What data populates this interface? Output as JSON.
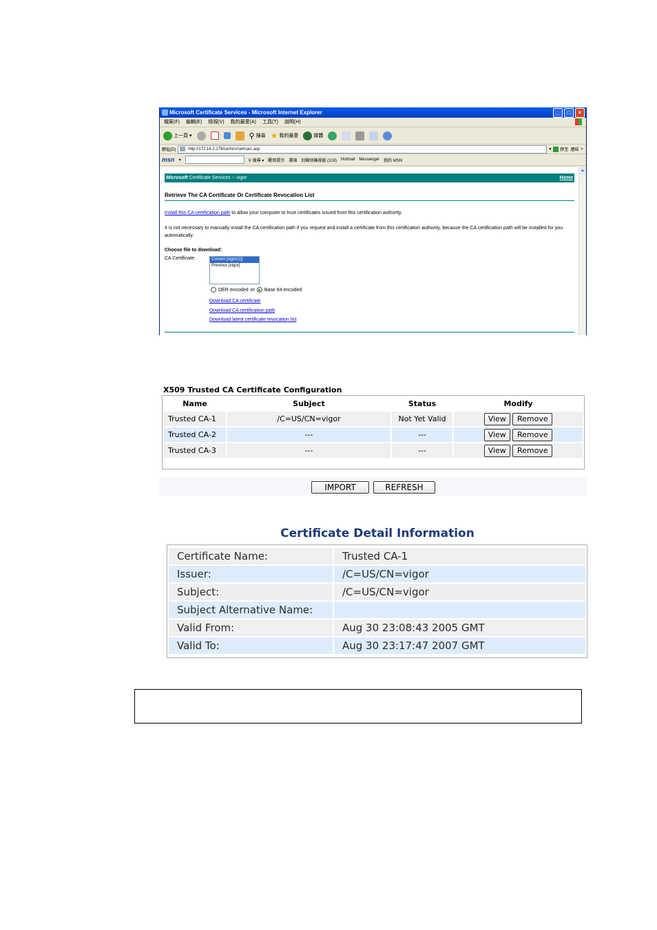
{
  "ie": {
    "title": "Microsoft Certificate Services - Microsoft Internet Explorer",
    "menu": [
      "檔案(F)",
      "編輯(E)",
      "檢視(V)",
      "我的最愛(A)",
      "工具(T)",
      "說明(H)"
    ],
    "toolbar": {
      "back": "上一頁",
      "search": "搜尋",
      "favorites": "我的最愛",
      "media": "媒體"
    },
    "address_label": "網址(D)",
    "address_value": "http://172.16.2.179/certsrv/certcarc.asp",
    "go_label": "移至",
    "links_label": "連結",
    "msn": {
      "logo": "msn",
      "search": "搜尋",
      "highlight": "醒目提示",
      "options": "選項",
      "blocked": "封鎖快顯視窗 (319)",
      "hotmail": "Hotmail",
      "messenger": "Messenger",
      "mymsn": "我的 MSN"
    },
    "page": {
      "brand": "Microsoft",
      "header_text": "Certificate Services -- vigor",
      "home": "Home",
      "title": "Retrieve The CA Certificate Or Certificate Revocation List",
      "install_link": "Install this CA certification path",
      "install_text": " to allow your computer to trust certificates issued from this certification authority.",
      "note": "It is not necessary to manually install the CA certification path if you request and install a certificate from this certification authority, because the CA certification path will be installed for you automatically.",
      "choose": "Choose file to download:",
      "ca_label": "CA Certificate:",
      "ca_options": [
        "Current [vigor(1)]",
        "Previous [vigor]"
      ],
      "der": "DER encoded",
      "or": "or",
      "base64": "Base 64 encoded",
      "links": [
        "Download CA certificate",
        "Download CA certification path",
        "Download latest certificate revocation list"
      ]
    }
  },
  "x509": {
    "title": "X509 Trusted CA Certificate Configuration",
    "headers": [
      "Name",
      "Subject",
      "Status",
      "Modify"
    ],
    "rows": [
      {
        "name": "Trusted CA-1",
        "subject": "/C=US/CN=vigor",
        "status": "Not Yet Valid"
      },
      {
        "name": "Trusted CA-2",
        "subject": "---",
        "status": "---"
      },
      {
        "name": "Trusted CA-3",
        "subject": "---",
        "status": "---"
      }
    ],
    "view_label": "View",
    "remove_label": "Remove",
    "import_label": "IMPORT",
    "refresh_label": "REFRESH"
  },
  "detail": {
    "title": "Certificate Detail Information",
    "rows": [
      {
        "key": "Certificate Name:",
        "value": "Trusted CA-1"
      },
      {
        "key": "Issuer:",
        "value": "/C=US/CN=vigor"
      },
      {
        "key": "Subject:",
        "value": "/C=US/CN=vigor"
      },
      {
        "key": "Subject Alternative Name:",
        "value": ""
      },
      {
        "key": "Valid From:",
        "value": "Aug 30 23:08:43 2005 GMT"
      },
      {
        "key": "Valid To:",
        "value": "Aug 30 23:17:47 2007 GMT"
      }
    ]
  }
}
